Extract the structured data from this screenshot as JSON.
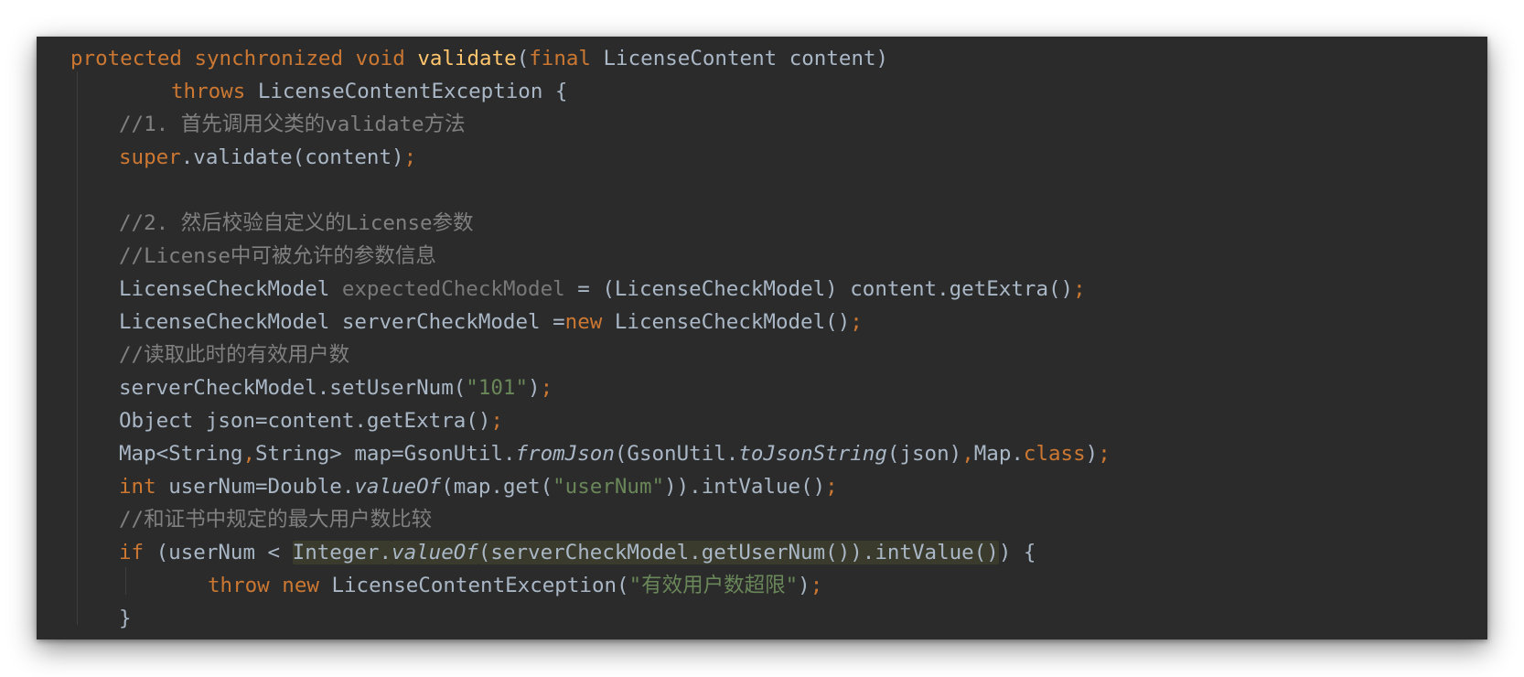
{
  "code": {
    "language": "java",
    "lines": [
      {
        "indent": 0,
        "tokens": [
          {
            "t": "protected ",
            "c": "kw"
          },
          {
            "t": "synchronized ",
            "c": "kw"
          },
          {
            "t": "void ",
            "c": "kw"
          },
          {
            "t": "validate",
            "c": "fn"
          },
          {
            "t": "(",
            "c": ""
          },
          {
            "t": "final ",
            "c": "kw"
          },
          {
            "t": "LicenseContent content)",
            "c": ""
          }
        ]
      },
      {
        "indent": 2,
        "tokens": [
          {
            "t": "throws ",
            "c": "kw"
          },
          {
            "t": "LicenseContentException {",
            "c": ""
          }
        ]
      },
      {
        "indent": 1,
        "tokens": [
          {
            "t": "//1. 首先调用父类的validate方法",
            "c": "cm"
          }
        ]
      },
      {
        "indent": 1,
        "tokens": [
          {
            "t": "super",
            "c": "kw"
          },
          {
            "t": ".validate(content)",
            "c": ""
          },
          {
            "t": ";",
            "c": "kw"
          }
        ]
      },
      {
        "indent": 0,
        "tokens": []
      },
      {
        "indent": 1,
        "tokens": [
          {
            "t": "//2. 然后校验自定义的License参数",
            "c": "cm"
          }
        ]
      },
      {
        "indent": 1,
        "tokens": [
          {
            "t": "//License中可被允许的参数信息",
            "c": "cm"
          }
        ]
      },
      {
        "indent": 1,
        "tokens": [
          {
            "t": "LicenseCheckModel ",
            "c": ""
          },
          {
            "t": "expectedCheckModel",
            "c": "gray"
          },
          {
            "t": " = (LicenseCheckModel) content.getExtra()",
            "c": ""
          },
          {
            "t": ";",
            "c": "kw"
          }
        ]
      },
      {
        "indent": 1,
        "tokens": [
          {
            "t": "LicenseCheckModel serverCheckModel =",
            "c": ""
          },
          {
            "t": "new ",
            "c": "kw"
          },
          {
            "t": "LicenseCheckModel()",
            "c": ""
          },
          {
            "t": ";",
            "c": "kw"
          }
        ]
      },
      {
        "indent": 1,
        "tokens": [
          {
            "t": "//读取此时的有效用户数",
            "c": "cm"
          }
        ]
      },
      {
        "indent": 1,
        "tokens": [
          {
            "t": "serverCheckModel.setUserNum(",
            "c": ""
          },
          {
            "t": "\"101\"",
            "c": "st"
          },
          {
            "t": ")",
            "c": ""
          },
          {
            "t": ";",
            "c": "kw"
          }
        ]
      },
      {
        "indent": 1,
        "tokens": [
          {
            "t": "Object json=content.getExtra()",
            "c": ""
          },
          {
            "t": ";",
            "c": "kw"
          }
        ]
      },
      {
        "indent": 1,
        "tokens": [
          {
            "t": "Map<String",
            "c": ""
          },
          {
            "t": ",",
            "c": "kw"
          },
          {
            "t": "String> map=GsonUtil.",
            "c": ""
          },
          {
            "t": "fromJson",
            "c": "it"
          },
          {
            "t": "(GsonUtil.",
            "c": ""
          },
          {
            "t": "toJsonString",
            "c": "it"
          },
          {
            "t": "(json)",
            "c": ""
          },
          {
            "t": ",",
            "c": "kw"
          },
          {
            "t": "Map.",
            "c": ""
          },
          {
            "t": "class",
            "c": "kw"
          },
          {
            "t": ")",
            "c": ""
          },
          {
            "t": ";",
            "c": "kw"
          }
        ]
      },
      {
        "indent": 1,
        "tokens": [
          {
            "t": "int ",
            "c": "kw"
          },
          {
            "t": "userNum=Double.",
            "c": ""
          },
          {
            "t": "valueOf",
            "c": "it"
          },
          {
            "t": "(map.get(",
            "c": ""
          },
          {
            "t": "\"userNum\"",
            "c": "st"
          },
          {
            "t": ")).intValue()",
            "c": ""
          },
          {
            "t": ";",
            "c": "kw"
          }
        ]
      },
      {
        "indent": 1,
        "tokens": [
          {
            "t": "//和证书中规定的最大用户数比较",
            "c": "cm"
          }
        ]
      },
      {
        "indent": 1,
        "tokens": [
          {
            "t": "if ",
            "c": "kw"
          },
          {
            "t": "(userNum < ",
            "c": ""
          },
          {
            "t": "Integer.",
            "c": "hl"
          },
          {
            "t": "valueOf",
            "c": "hl it"
          },
          {
            "t": "(serverCheckModel.getUserNum()).intValue()",
            "c": "hl"
          },
          {
            "t": ") {",
            "c": ""
          }
        ]
      },
      {
        "indent": 3,
        "tokens": [
          {
            "t": "throw ",
            "c": "kw"
          },
          {
            "t": "new ",
            "c": "kw"
          },
          {
            "t": "LicenseContentException(",
            "c": ""
          },
          {
            "t": "\"有效用户数超限\"",
            "c": "st"
          },
          {
            "t": ")",
            "c": ""
          },
          {
            "t": ";",
            "c": "kw"
          }
        ]
      },
      {
        "indent": 1,
        "tokens": [
          {
            "t": "}",
            "c": ""
          }
        ]
      }
    ]
  },
  "colors": {
    "background": "#2b2b2b",
    "text": "#a9b7c6",
    "keyword": "#cc7832",
    "method": "#ffc66d",
    "comment": "#808080",
    "string": "#6a8759"
  }
}
